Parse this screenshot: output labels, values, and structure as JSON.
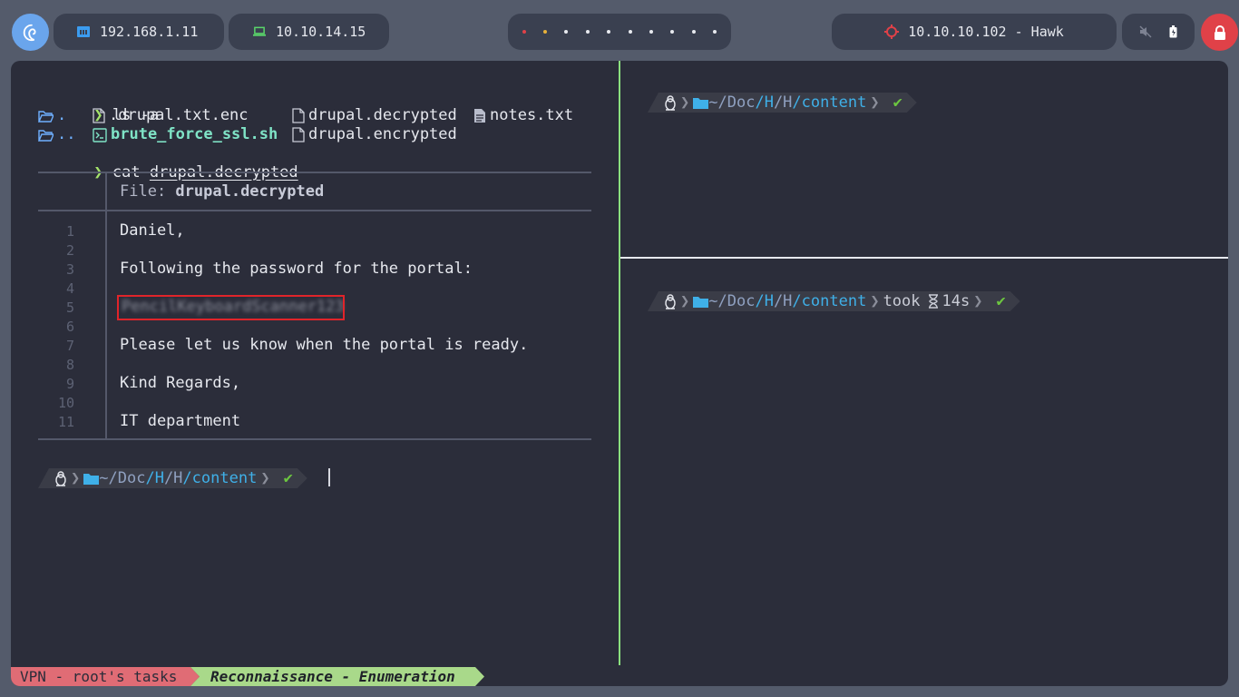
{
  "topbar": {
    "host_ip": "192.168.1.11",
    "vpn_ip": "10.10.14.15",
    "workspaces": [
      {
        "color": "#e04148"
      },
      {
        "color": "#e8b13a"
      },
      {
        "color": "#e8eaf0"
      },
      {
        "color": "#e8eaf0"
      },
      {
        "color": "#e8eaf0"
      },
      {
        "color": "#e8eaf0"
      },
      {
        "color": "#e8eaf0"
      },
      {
        "color": "#e8eaf0"
      },
      {
        "color": "#e8eaf0"
      },
      {
        "color": "#e8eaf0"
      }
    ],
    "target": "10.10.10.102 - Hawk",
    "icons": [
      "debian-icon",
      "ethernet-icon",
      "laptop-icon",
      "target-icon",
      "mute-icon",
      "battery-icon",
      "lock-icon"
    ]
  },
  "left_pane": {
    "cmd1_prompt": "❯",
    "cmd1": "ls -a",
    "ls": {
      "dot": ".",
      "dotdot": "..",
      "f1": ".drupal.txt.enc",
      "f2": "brute_force_ssl.sh",
      "f3": "drupal.decrypted",
      "f4": "drupal.encrypted",
      "f5": "notes.txt"
    },
    "cmd2_prompt": "❯",
    "cmd2_name": "cat",
    "cmd2_arg": "drupal.decrypted",
    "bat": {
      "file_label": "File: ",
      "file_name": "drupal.decrypted",
      "line_numbers": [
        "1",
        "2",
        "3",
        "4",
        "5",
        "6",
        "7",
        "8",
        "9",
        "10",
        "11"
      ],
      "lines": [
        "Daniel,",
        "",
        "Following the password for the portal:",
        "",
        "PencilKeyboardScanner123",
        "",
        "Please let us know when the portal is ready.",
        "",
        "Kind Regards,",
        "",
        "IT department"
      ]
    },
    "prompt": {
      "home": "~",
      "p1": "/Doc",
      "p2": "/H",
      "p3": "/H",
      "p4": "/content",
      "check": "✔"
    }
  },
  "right_top": {
    "prompt": {
      "home": "~",
      "p1": "/Doc",
      "p2": "/H",
      "p3": "/H",
      "p4": "/content",
      "check": "✔"
    }
  },
  "right_bottom": {
    "prompt": {
      "home": "~",
      "p1": "/Doc",
      "p2": "/H",
      "p3": "/H",
      "p4": "/content",
      "took": "took",
      "duration": "14s",
      "check": "✔"
    }
  },
  "statusbar": {
    "vpn_tab": "VPN - root's tasks",
    "recon_tab": "Reconnaissance - Enumeration"
  }
}
